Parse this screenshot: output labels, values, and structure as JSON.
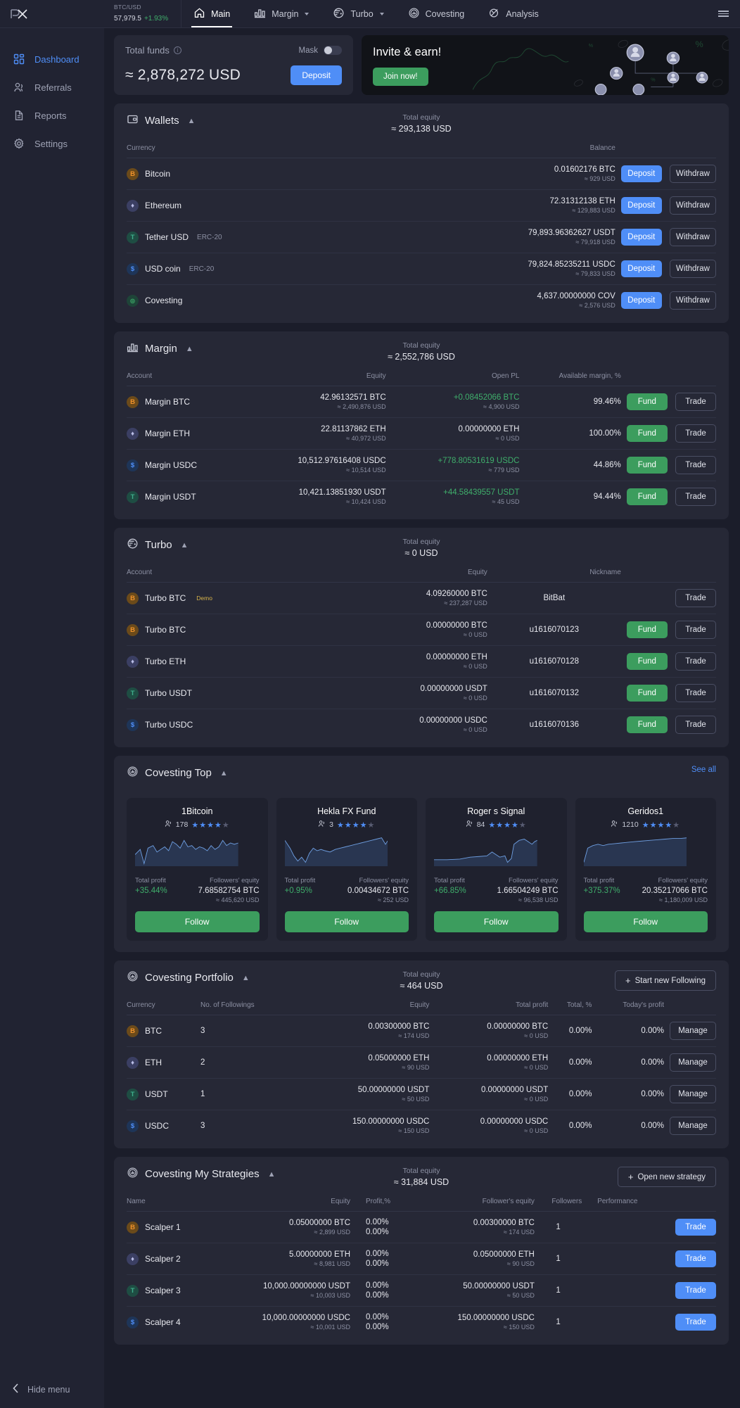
{
  "topbar": {
    "ticker": {
      "pair": "BTC/USD",
      "price": "57,979.5",
      "change": "+1.93%"
    },
    "tabs": [
      {
        "label": "Main",
        "icon": "home-icon",
        "active": true,
        "caret": false
      },
      {
        "label": "Margin",
        "icon": "bars-icon",
        "active": false,
        "caret": true
      },
      {
        "label": "Turbo",
        "icon": "turbo-icon",
        "active": false,
        "caret": true
      },
      {
        "label": "Covesting",
        "icon": "covesting-icon",
        "active": false,
        "caret": false
      },
      {
        "label": "Analysis",
        "icon": "analysis-icon",
        "active": false,
        "caret": false
      }
    ]
  },
  "sidebar": {
    "items": [
      {
        "label": "Dashboard",
        "icon": "grid-icon",
        "active": true
      },
      {
        "label": "Referrals",
        "icon": "users-icon",
        "active": false
      },
      {
        "label": "Reports",
        "icon": "document-icon",
        "active": false
      },
      {
        "label": "Settings",
        "icon": "gear-icon",
        "active": false
      }
    ],
    "hide_menu": "Hide menu"
  },
  "total_funds": {
    "title": "Total funds",
    "amount": "≈ 2,878,272 USD",
    "mask_label": "Mask",
    "deposit_label": "Deposit"
  },
  "invite": {
    "title": "Invite & earn!",
    "cta": "Join now!"
  },
  "wallets": {
    "title": "Wallets",
    "equity_label": "Total equity",
    "equity_value": "≈ 293,138 USD",
    "columns": [
      "Currency",
      "Balance"
    ],
    "deposit_label": "Deposit",
    "withdraw_label": "Withdraw",
    "rows": [
      {
        "coin": "btc",
        "name": "Bitcoin",
        "tag": "",
        "balance": "0.01602176 BTC",
        "usd": "≈ 929 USD"
      },
      {
        "coin": "eth",
        "name": "Ethereum",
        "tag": "",
        "balance": "72.31312138 ETH",
        "usd": "≈ 129,883 USD"
      },
      {
        "coin": "usdt",
        "name": "Tether USD",
        "tag": "ERC-20",
        "balance": "79,893.96362627 USDT",
        "usd": "≈ 79,918 USD"
      },
      {
        "coin": "usdc",
        "name": "USD coin",
        "tag": "ERC-20",
        "balance": "79,824.85235211 USDC",
        "usd": "≈ 79,833 USD"
      },
      {
        "coin": "cov",
        "name": "Covesting",
        "tag": "",
        "balance": "4,637.00000000 COV",
        "usd": "≈ 2,576 USD"
      }
    ]
  },
  "margin": {
    "title": "Margin",
    "equity_label": "Total equity",
    "equity_value": "≈ 2,552,786 USD",
    "columns": [
      "Account",
      "Equity",
      "Open PL",
      "Available margin, %"
    ],
    "fund_label": "Fund",
    "trade_label": "Trade",
    "rows": [
      {
        "coin": "btc",
        "name": "Margin BTC",
        "equity": "42.96132571 BTC",
        "equity_usd": "≈ 2,490,876 USD",
        "pl": "+0.08452066 BTC",
        "pl_usd": "≈ 4,900 USD",
        "pl_positive": true,
        "margin": "99.46%"
      },
      {
        "coin": "eth",
        "name": "Margin ETH",
        "equity": "22.81137862 ETH",
        "equity_usd": "≈ 40,972 USD",
        "pl": "0.00000000 ETH",
        "pl_usd": "≈ 0 USD",
        "pl_positive": false,
        "margin": "100.00%"
      },
      {
        "coin": "usdc",
        "name": "Margin USDC",
        "equity": "10,512.97616408 USDC",
        "equity_usd": "≈ 10,514 USD",
        "pl": "+778.80531619 USDC",
        "pl_usd": "≈ 779 USD",
        "pl_positive": true,
        "margin": "44.86%"
      },
      {
        "coin": "usdt",
        "name": "Margin USDT",
        "equity": "10,421.13851930 USDT",
        "equity_usd": "≈ 10,424 USD",
        "pl": "+44.58439557 USDT",
        "pl_usd": "≈ 45 USD",
        "pl_positive": true,
        "margin": "94.44%"
      }
    ]
  },
  "turbo": {
    "title": "Turbo",
    "equity_label": "Total equity",
    "equity_value": "≈ 0 USD",
    "columns": [
      "Account",
      "Equity",
      "Nickname"
    ],
    "fund_label": "Fund",
    "trade_label": "Trade",
    "rows": [
      {
        "coin": "btc",
        "name": "Turbo BTC",
        "demo": "Demo",
        "equity": "4.09260000 BTC",
        "equity_usd": "≈ 237,287 USD",
        "nickname": "BitBat",
        "has_fund": false
      },
      {
        "coin": "btc",
        "name": "Turbo BTC",
        "demo": "",
        "equity": "0.00000000 BTC",
        "equity_usd": "≈ 0 USD",
        "nickname": "u1616070123",
        "has_fund": true
      },
      {
        "coin": "eth",
        "name": "Turbo ETH",
        "demo": "",
        "equity": "0.00000000 ETH",
        "equity_usd": "≈ 0 USD",
        "nickname": "u1616070128",
        "has_fund": true
      },
      {
        "coin": "usdt",
        "name": "Turbo USDT",
        "demo": "",
        "equity": "0.00000000 USDT",
        "equity_usd": "≈ 0 USD",
        "nickname": "u1616070132",
        "has_fund": true
      },
      {
        "coin": "usdc",
        "name": "Turbo USDC",
        "demo": "",
        "equity": "0.00000000 USDC",
        "equity_usd": "≈ 0 USD",
        "nickname": "u1616070136",
        "has_fund": true
      }
    ]
  },
  "covesting_top": {
    "title": "Covesting Top",
    "see_all": "See all",
    "profit_label": "Total profit",
    "followers_equity_label": "Followers' equity",
    "follow_label": "Follow",
    "cards": [
      {
        "name": "1Bitcoin",
        "followers": "178",
        "stars": 4,
        "profit": "+35.44%",
        "equity": "7.68582754 BTC",
        "equity_usd": "≈ 445,620 USD",
        "spark": "0,30 8,22 14,44 20,20 28,16 34,26 40,22 46,18 52,24 58,10 64,14 70,20 76,8 82,18 88,16 94,22 100,18 106,20 112,24 118,16 124,22 130,18 136,8 142,16 148,12 154,14 160,12"
      },
      {
        "name": "Hekla FX Fund",
        "followers": "3",
        "stars": 4,
        "profit": "+0.95%",
        "equity": "0.00434672 BTC",
        "equity_usd": "≈ 252 USD",
        "spark": "0,8 8,20 14,32 20,40 26,34 32,42 38,28 44,20 50,24 56,22 62,24 70,26 78,22 86,20 94,18 102,16 110,14 118,12 126,10 134,8 142,6 150,4 156,14 160,8"
      },
      {
        "name": "Roger s Signal",
        "followers": "84",
        "stars": 4,
        "profit": "+66.85%",
        "equity": "1.66504249 BTC",
        "equity_usd": "≈ 96,538 USD",
        "spark": "0,38 20,38 40,37 56,34 70,33 82,32 90,26 96,30 102,34 110,32 114,42 120,36 124,14 132,8 140,6 146,10 152,14 156,10 160,8"
      },
      {
        "name": "Geridos1",
        "followers": "1210",
        "stars": 4,
        "profit": "+375.37%",
        "equity": "20.35217066 BTC",
        "equity_usd": "≈ 1,180,009 USD",
        "spark": "0,42 6,20 14,16 22,14 30,16 38,14 48,13 58,12 68,11 78,10 90,9 102,8 114,7 126,6 138,5 150,5 160,4"
      }
    ]
  },
  "covesting_portfolio": {
    "title": "Covesting Portfolio",
    "equity_label": "Total equity",
    "equity_value": "≈ 464 USD",
    "action_label": "Start new Following",
    "manage_label": "Manage",
    "columns": [
      "Currency",
      "No. of Followings",
      "Equity",
      "Total profit",
      "Total, %",
      "Today's profit"
    ],
    "rows": [
      {
        "coin": "btc",
        "name": "BTC",
        "followings": "3",
        "equity": "0.00300000 BTC",
        "equity_usd": "≈ 174 USD",
        "profit": "0.00000000 BTC",
        "profit_usd": "≈ 0 USD",
        "total_pct": "0.00%",
        "today": "0.00%"
      },
      {
        "coin": "eth",
        "name": "ETH",
        "followings": "2",
        "equity": "0.05000000 ETH",
        "equity_usd": "≈ 90 USD",
        "profit": "0.00000000 ETH",
        "profit_usd": "≈ 0 USD",
        "total_pct": "0.00%",
        "today": "0.00%"
      },
      {
        "coin": "usdt",
        "name": "USDT",
        "followings": "1",
        "equity": "50.00000000 USDT",
        "equity_usd": "≈ 50 USD",
        "profit": "0.00000000 USDT",
        "profit_usd": "≈ 0 USD",
        "total_pct": "0.00%",
        "today": "0.00%"
      },
      {
        "coin": "usdc",
        "name": "USDC",
        "followings": "3",
        "equity": "150.00000000 USDC",
        "equity_usd": "≈ 150 USD",
        "profit": "0.00000000 USDC",
        "profit_usd": "≈ 0 USD",
        "total_pct": "0.00%",
        "today": "0.00%"
      }
    ]
  },
  "covesting_strategies": {
    "title": "Covesting My Strategies",
    "equity_label": "Total equity",
    "equity_value": "≈ 31,884 USD",
    "action_label": "Open new strategy",
    "trade_label": "Trade",
    "columns": [
      "Name",
      "Equity",
      "Profit,%",
      "Follower's equity",
      "Followers",
      "Performance"
    ],
    "rows": [
      {
        "coin": "btc",
        "name": "Scalper 1",
        "equity": "0.05000000 BTC",
        "equity_usd": "≈ 2,899 USD",
        "profit1": "0.00%",
        "profit2": "0.00%",
        "fequity": "0.00300000 BTC",
        "fequity_usd": "≈ 174 USD",
        "followers": "1"
      },
      {
        "coin": "eth",
        "name": "Scalper 2",
        "equity": "5.00000000 ETH",
        "equity_usd": "≈ 8,981 USD",
        "profit1": "0.00%",
        "profit2": "0.00%",
        "fequity": "0.05000000 ETH",
        "fequity_usd": "≈ 90 USD",
        "followers": "1"
      },
      {
        "coin": "usdt",
        "name": "Scalper 3",
        "equity": "10,000.00000000 USDT",
        "equity_usd": "≈ 10,003 USD",
        "profit1": "0.00%",
        "profit2": "0.00%",
        "fequity": "50.00000000 USDT",
        "fequity_usd": "≈ 50 USD",
        "followers": "1"
      },
      {
        "coin": "usdc",
        "name": "Scalper 4",
        "equity": "10,000.00000000 USDC",
        "equity_usd": "≈ 10,001 USD",
        "profit1": "0.00%",
        "profit2": "0.00%",
        "fequity": "150.00000000 USDC",
        "fequity_usd": "≈ 150 USD",
        "followers": "1"
      }
    ]
  },
  "colors": {
    "accent_blue": "#4f8ef7",
    "accent_green": "#3c9d5e",
    "positive": "#3fae6b",
    "bg": "#1b1d2a",
    "panel": "#262836"
  }
}
